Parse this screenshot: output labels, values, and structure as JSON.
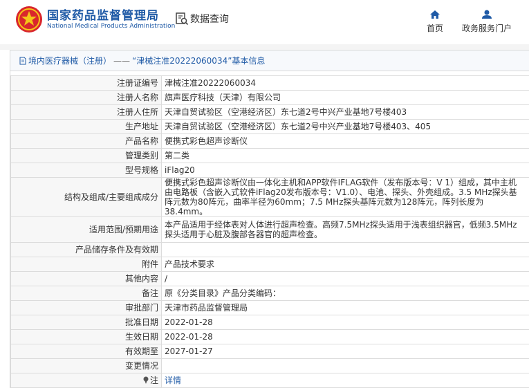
{
  "header": {
    "brand_cn": "国家药品监督管理局",
    "brand_en": "National Medical Products Administration",
    "query_label": "数据查询",
    "nav": [
      {
        "label": "首页",
        "icon": "home-icon"
      },
      {
        "label": "政务服务门户",
        "icon": "user-icon"
      }
    ]
  },
  "colors": {
    "brand_blue": "#1f5aa6",
    "logo_red": "#d9262c",
    "logo_gold": "#f5c518"
  },
  "card": {
    "breadcrumb_section": "境内医疗器械（注册）",
    "breadcrumb_sep": "——",
    "breadcrumb_title": "“津械注准20222060034”基本信息"
  },
  "rows": [
    {
      "label": "注册证编号",
      "value": "津械注准20222060034"
    },
    {
      "label": "注册人名称",
      "value": "旗声医疗科技（天津）有限公司"
    },
    {
      "label": "注册人住所",
      "value": "天津自贸试验区（空港经济区）东七道2号中兴产业基地7号楼403"
    },
    {
      "label": "生产地址",
      "value": "天津自贸试验区（空港经济区）东七道2号中兴产业基地7号楼403、405"
    },
    {
      "label": "产品名称",
      "value": "便携式彩色超声诊断仪"
    },
    {
      "label": "管理类别",
      "value": "第二类"
    },
    {
      "label": "型号规格",
      "value": "iFlag20"
    },
    {
      "label": "结构及组成/主要组成成分",
      "value": "便携式彩色超声诊断仪由一体化主机和APP软件IFLAG软件（发布版本号：V 1）组成，其中主机由电路板（含嵌入式软件iFlag20发布版本号：V1.0）、电池、探头、外壳组成。3.5 MHz探头基阵元数为80阵元，曲率半径为60mm；7.5 MHz探头基阵元数为128阵元，阵列长度为38.4mm。"
    },
    {
      "label": "适用范围/预期用途",
      "value": "本产品适用于经体表对人体进行超声检查。高频7.5MHz探头适用于浅表组织器官，低频3.5MHz探头适用于心脏及腹部各器官的超声检查。"
    },
    {
      "label": "产品储存条件及有效期",
      "value": ""
    },
    {
      "label": "附件",
      "value": "产品技术要求"
    },
    {
      "label": "其他内容",
      "value": "/"
    },
    {
      "label": "备注",
      "value": "原《分类目录》产品分类编码："
    },
    {
      "label": "审批部门",
      "value": "天津市药品监督管理局"
    },
    {
      "label": "批准日期",
      "value": "2022-01-28"
    },
    {
      "label": "生效日期",
      "value": "2022-01-28"
    },
    {
      "label": "有效期至",
      "value": "2027-01-27"
    },
    {
      "label": "变更情况",
      "value": ""
    }
  ],
  "note_row": {
    "label": "注",
    "icon": "pin-icon",
    "link": "详情"
  }
}
